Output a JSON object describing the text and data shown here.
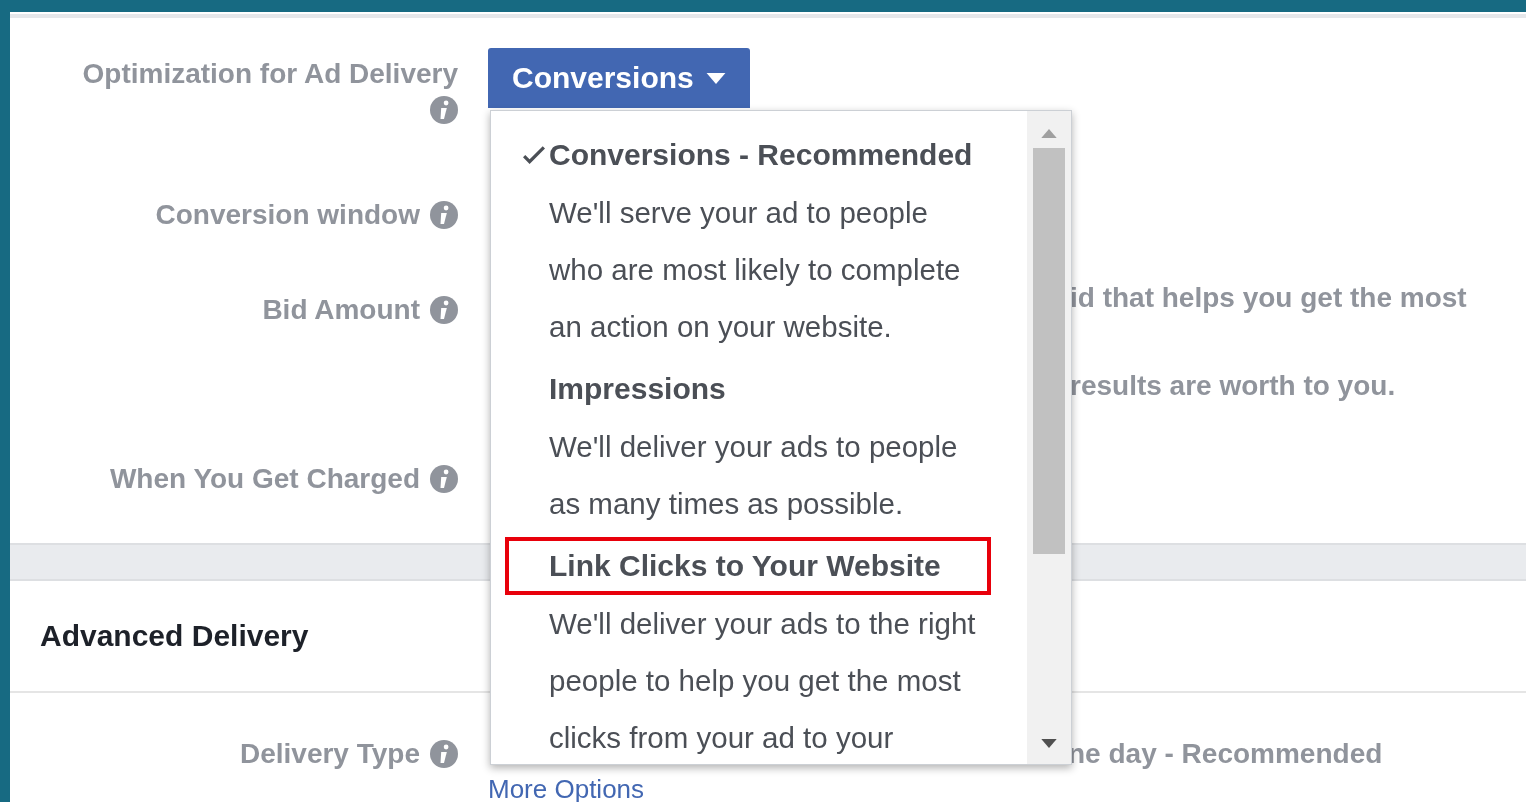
{
  "fields": [
    {
      "label": "Optimization for Ad Delivery",
      "kind": "dropdown",
      "value": "Conversions"
    },
    {
      "label": "Conversion window",
      "kind": "blank"
    },
    {
      "label": "Bid Amount",
      "kind": "text",
      "lines": [
        "id that helps you get the most",
        "results are worth to you."
      ]
    },
    {
      "label": "When You Get Charged",
      "kind": "blank"
    }
  ],
  "section": {
    "title": "Advanced Delivery"
  },
  "delivery": {
    "label": "Delivery Type",
    "value": "ne day - Recommended",
    "link": "More Options"
  },
  "menu": {
    "options": [
      {
        "title": "Conversions - Recommended",
        "description": "We'll serve your ad to people who are most likely to complete an action on your website.",
        "selected": true,
        "highlighted": false
      },
      {
        "title": "Impressions",
        "description": "We'll deliver your ads to people as many times as possible.",
        "selected": false,
        "highlighted": false
      },
      {
        "title": "Link Clicks to Your Website",
        "description": "We'll deliver your ads to the right people to help you get the most clicks from your ad to your",
        "selected": false,
        "highlighted": true
      }
    ]
  }
}
